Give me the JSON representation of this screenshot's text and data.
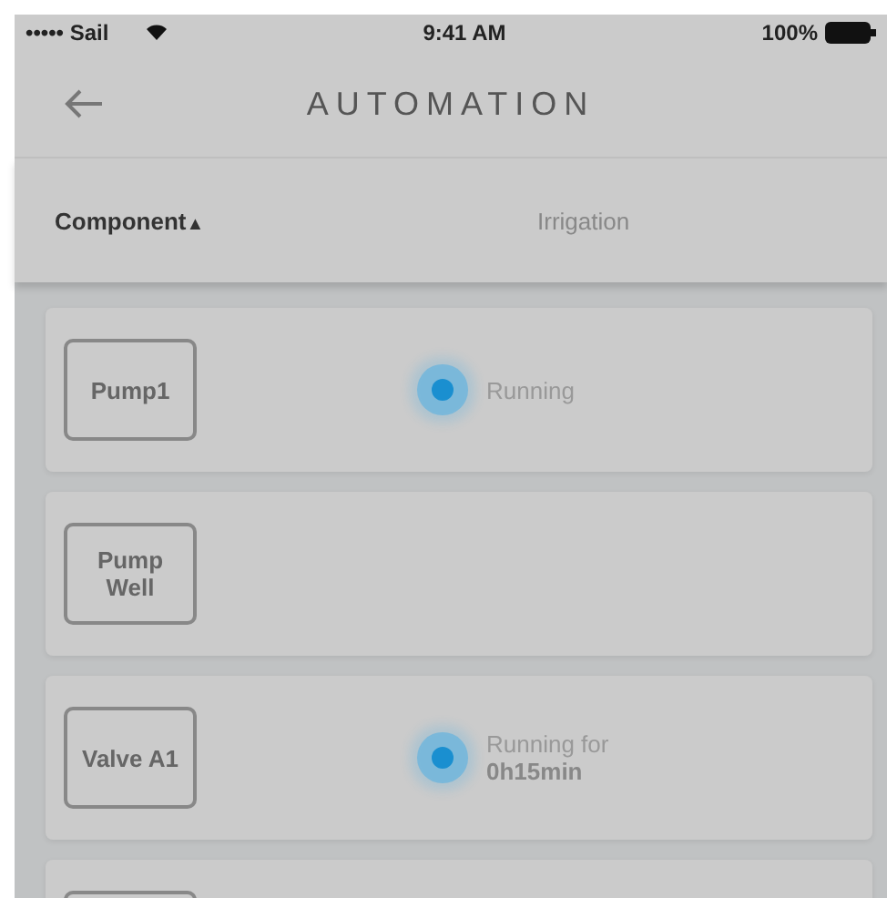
{
  "status_bar": {
    "carrier": "••••• Sail",
    "time": "9:41 AM",
    "battery": "100%"
  },
  "header": {
    "title": "AUTOMATION"
  },
  "columns": [
    {
      "label": "Component",
      "sort": "▲"
    },
    {
      "label": "Irrigation"
    }
  ],
  "rows": [
    {
      "component": "Pump1",
      "running": true,
      "status": "Running"
    },
    {
      "component": "Pump Well",
      "running": false
    },
    {
      "component": "Valve A1",
      "running": true,
      "status": "Running for",
      "duration": "0h15min"
    },
    {
      "running": false
    }
  ]
}
